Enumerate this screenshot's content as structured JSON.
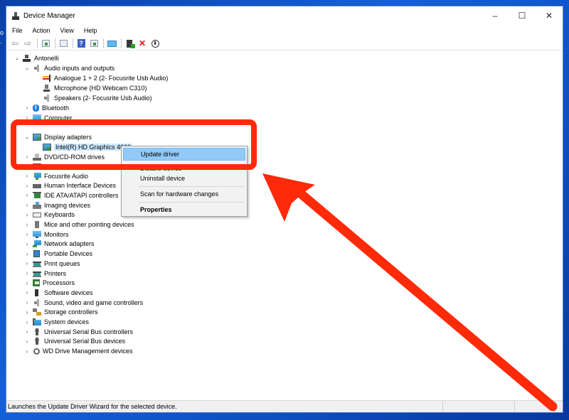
{
  "desktop": {
    "edge_glyphs": "o\n."
  },
  "window": {
    "title": "Device Manager",
    "caption_buttons": {
      "minimize": "–",
      "maximize": "☐",
      "close": "✕"
    }
  },
  "menu": [
    "File",
    "Action",
    "View",
    "Help"
  ],
  "toolbar": {
    "back": "⇦",
    "forward": "⇨",
    "help": "?",
    "uninstall": "✕",
    "update": "⬇"
  },
  "tree": {
    "root": "Antonelli",
    "audio": {
      "label": "Audio inputs and outputs",
      "children": [
        "Analogue 1 + 2 (2- Focusrite Usb Audio)",
        "Microphone (HD Webcam C310)",
        "Speakers (2- Focusrite Usb Audio)"
      ]
    },
    "bluetooth": "Bluetooth",
    "bluetooth_glyph": "ᛒ",
    "computer": "Computer",
    "display": {
      "label": "Display adapters",
      "child": "Intel(R) HD Graphics 4600"
    },
    "categories": [
      "DVD/CD-ROM drives",
      "Firmware",
      "Focusrite Audio",
      "Human Interface Devices",
      "IDE ATA/ATAPI controllers",
      "Imaging devices",
      "Keyboards",
      "Mice and other pointing devices",
      "Monitors",
      "Network adapters",
      "Portable Devices",
      "Print queues",
      "Printers",
      "Processors",
      "Software devices",
      "Sound, video and game controllers",
      "Storage controllers",
      "System devices",
      "Universal Serial Bus controllers",
      "Universal Serial Bus devices",
      "WD Drive Management devices"
    ],
    "chevron_collapsed": "›",
    "chevron_expanded": "⌄"
  },
  "context_menu": {
    "items": [
      "Update driver",
      "Disable device",
      "Uninstall device",
      "Scan for hardware changes",
      "Properties"
    ],
    "highlighted": "Update driver"
  },
  "statusbar": {
    "text": "Launches the Update Driver Wizard for the selected device."
  },
  "annotation": {
    "color": "#ff2a0a"
  }
}
